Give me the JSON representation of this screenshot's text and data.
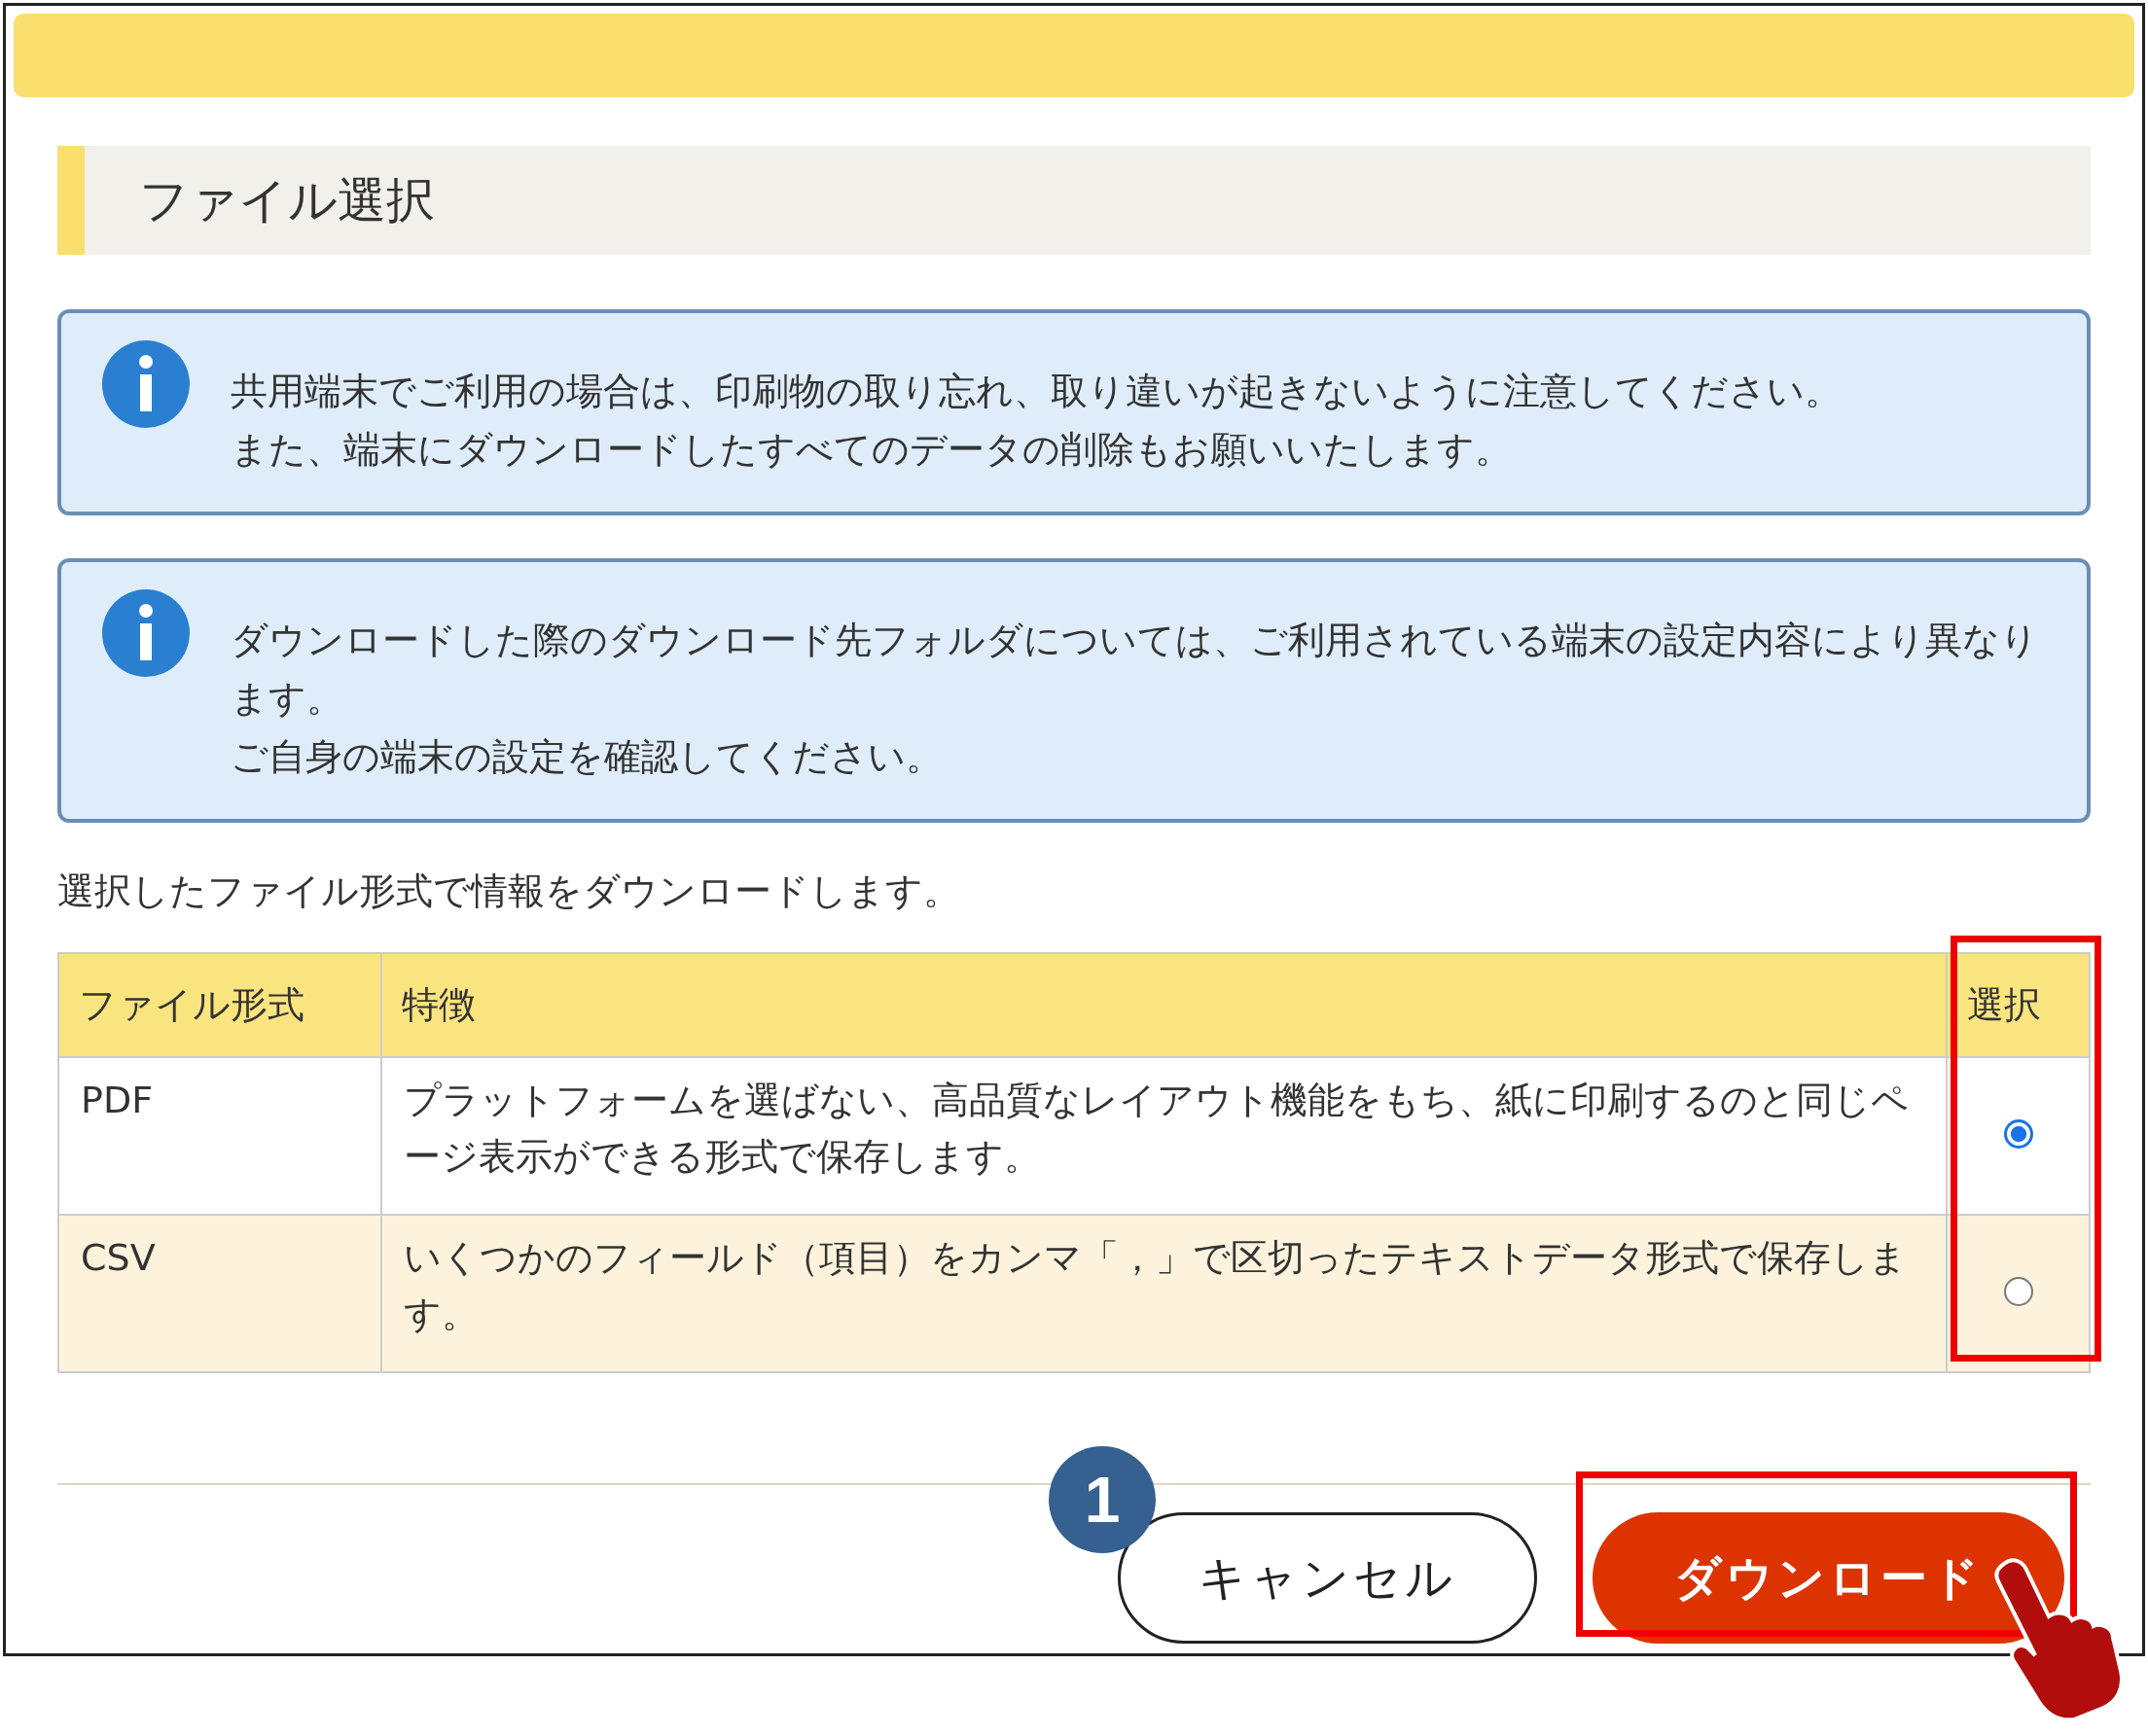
{
  "dialog_title": "ファイル選択",
  "notices": [
    {
      "paragraphs": [
        "共用端末でご利用の場合は、印刷物の取り忘れ、取り違いが起きないように注意してください。",
        "また、端末にダウンロードしたすべてのデータの削除もお願いいたします。"
      ]
    },
    {
      "paragraphs": [
        "ダウンロードした際のダウンロード先フォルダについては、ご利用されている端末の設定内容により異なります。",
        "ご自身の端末の設定を確認してください。"
      ]
    }
  ],
  "instruction": "選択したファイル形式で情報をダウンロードします。",
  "table": {
    "columns": [
      "ファイル形式",
      "特徴",
      "選択"
    ],
    "rows": [
      {
        "format": "PDF",
        "description": "プラットフォームを選ばない、高品質なレイアウト機能をもち、紙に印刷するのと同じページ表示ができる形式で保存します。",
        "selected": true
      },
      {
        "format": "CSV",
        "description": "いくつかのフィールド（項目）をカンマ「，」で区切ったテキストデータ形式で保存します。",
        "selected": false
      }
    ]
  },
  "buttons": [
    {
      "label": "キャンセル",
      "kind": "secondary"
    },
    {
      "label": "ダウンロード",
      "kind": "primary"
    }
  ],
  "step_badge": "1"
}
